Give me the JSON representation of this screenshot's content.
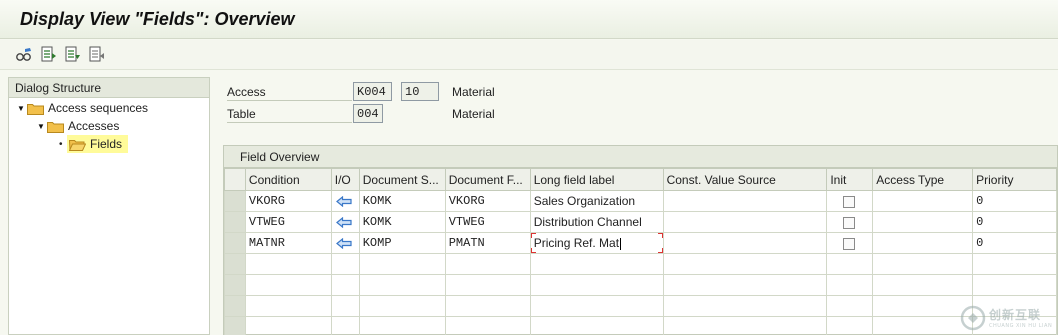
{
  "window": {
    "title": "Display View \"Fields\": Overview"
  },
  "toolbar": {
    "buttons": [
      {
        "icon": "glasses-icon"
      },
      {
        "icon": "previous-entry-icon"
      },
      {
        "icon": "next-entry-icon"
      },
      {
        "icon": "other-entry-icon"
      }
    ]
  },
  "dialog_structure": {
    "header": "Dialog Structure",
    "items": [
      {
        "label": "Access sequences",
        "level": 0,
        "expanded": true
      },
      {
        "label": "Accesses",
        "level": 1,
        "expanded": true
      },
      {
        "label": "Fields",
        "level": 2,
        "selected": true
      }
    ]
  },
  "header_fields": {
    "access": {
      "label": "Access",
      "value": "K004",
      "value2": "10",
      "description": "Material"
    },
    "table": {
      "label": "Table",
      "value": "004",
      "description": "Material"
    }
  },
  "field_overview": {
    "title": "Field Overview",
    "columns": [
      "Condition",
      "I/O",
      "Document S...",
      "Document F...",
      "Long field label",
      "Const. Value Source",
      "Init",
      "Access Type",
      "Priority"
    ],
    "rows": [
      {
        "condition": "VKORG",
        "io": "left-arrow-icon",
        "doc_s": "KOMK",
        "doc_f": "VKORG",
        "label": "Sales Organization",
        "const": "",
        "init": false,
        "access_type": "",
        "priority": "0"
      },
      {
        "condition": "VTWEG",
        "io": "left-arrow-icon",
        "doc_s": "KOMK",
        "doc_f": "VTWEG",
        "label": "Distribution Channel",
        "const": "",
        "init": false,
        "access_type": "",
        "priority": "0"
      },
      {
        "condition": "MATNR",
        "io": "left-arrow-icon",
        "doc_s": "KOMP",
        "doc_f": "PMATN",
        "label": "Pricing Ref. Mat",
        "const": "",
        "init": false,
        "access_type": "",
        "priority": "0"
      }
    ],
    "empty_rows": 4
  },
  "watermark": {
    "main": "创新互联",
    "sub": "CHUANG XIN HU LIAN"
  },
  "colors": {
    "selected_tree_bg": "#fffb9a",
    "folder": "#f2c04b",
    "arrow": "#3a78c8"
  }
}
